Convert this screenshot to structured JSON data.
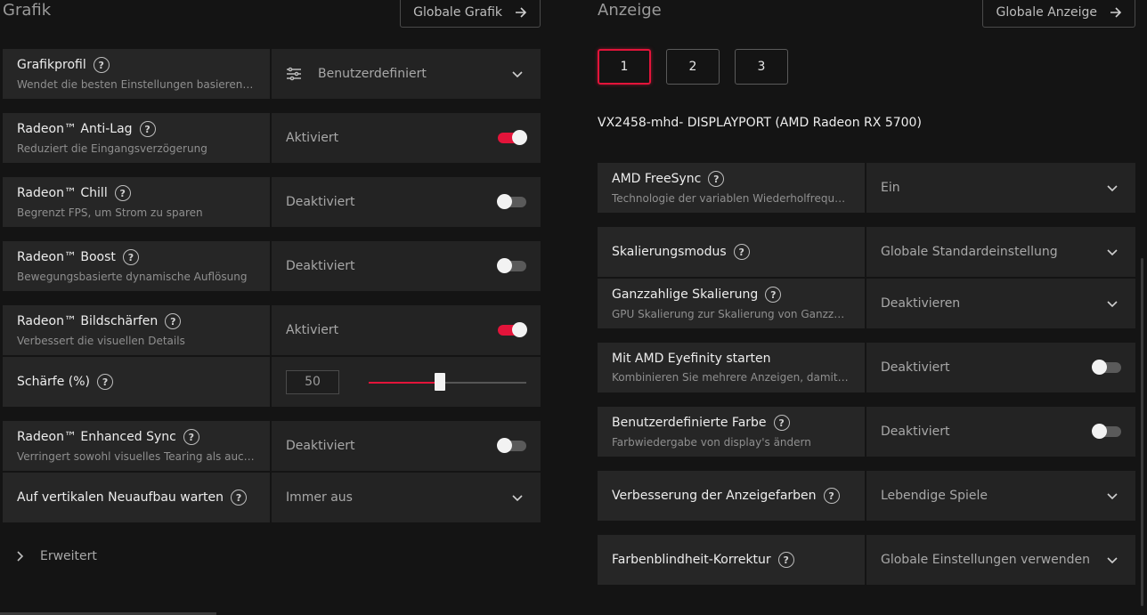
{
  "graphics": {
    "title": "Grafik",
    "global_button": "Globale Grafik",
    "rows": [
      {
        "label": "Grafikprofil",
        "desc": "Wendet die besten Einstellungen basierend a...",
        "value": "Benutzerdefiniert"
      },
      {
        "label": "Radeon™ Anti-Lag",
        "desc": "Reduziert die Eingangsverzögerung",
        "value": "Aktiviert",
        "toggle": true
      },
      {
        "label": "Radeon™ Chill",
        "desc": "Begrenzt FPS, um Strom zu sparen",
        "value": "Deaktiviert",
        "toggle": false
      },
      {
        "label": "Radeon™ Boost",
        "desc": "Bewegungsbasierte dynamische Auflösung",
        "value": "Deaktiviert",
        "toggle": false
      },
      {
        "label": "Radeon™ Bildschärfen",
        "desc": "Verbessert die visuellen Details",
        "value": "Aktiviert",
        "toggle": true
      },
      {
        "label": "Schärfe (%)",
        "value": "50",
        "slider_percent": 45
      },
      {
        "label": "Radeon™ Enhanced Sync",
        "desc": "Verringert sowohl visuelles Tearing als auch L...",
        "value": "Deaktiviert",
        "toggle": false
      },
      {
        "label": "Auf vertikalen Neuaufbau warten",
        "value": "Immer aus"
      }
    ],
    "advanced_label": "Erweitert"
  },
  "display": {
    "title": "Anzeige",
    "global_button": "Globale Anzeige",
    "tabs": [
      "1",
      "2",
      "3"
    ],
    "active_tab": "1",
    "monitor_name": "VX2458-mhd- DISPLAYPORT (AMD Radeon RX 5700)",
    "rows": [
      {
        "label": "AMD FreeSync",
        "desc": "Technologie der variablen Wiederholfrequenz.",
        "value": "Ein"
      },
      {
        "label": "Skalierungsmodus",
        "value": "Globale Standardeinstellung"
      },
      {
        "label": "Ganzzahlige Skalierung",
        "desc": "GPU Skalierung zur Skalierung von Ganzzahle...",
        "value": "Deaktivieren"
      },
      {
        "label": "Mit AMD Eyefinity starten",
        "desc": "Kombinieren Sie mehrere Anzeigen, damit di...",
        "value": "Deaktiviert",
        "toggle": false
      },
      {
        "label": "Benutzerdefinierte Farbe",
        "desc": "Farbwiedergabe von display's ändern",
        "value": "Deaktiviert",
        "toggle": false
      },
      {
        "label": "Verbesserung der Anzeigefarben",
        "value": "Lebendige Spiele"
      },
      {
        "label": "Farbenblindheit-Korrektur",
        "value": "Globale Einstellungen verwenden"
      }
    ]
  },
  "colors": {
    "accent": "#e3143a",
    "row_bg": "#262626",
    "page_bg": "#141414"
  },
  "icons": [
    "help-icon",
    "arrow-right-icon",
    "chevron-down-icon",
    "chevron-right-icon",
    "profile-sliders-icon"
  ]
}
